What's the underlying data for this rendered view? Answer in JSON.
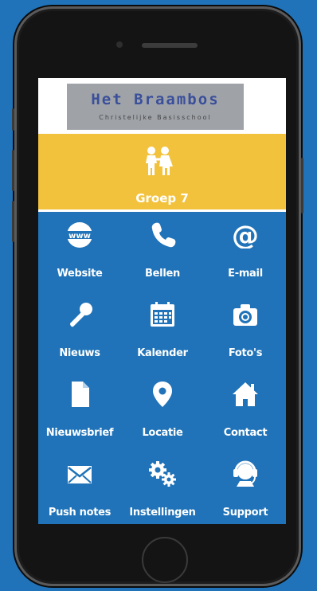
{
  "header": {
    "logo_title": "Het Braambos",
    "logo_subtitle": "Christelijke Basisschool"
  },
  "group": {
    "label": "Groep 7",
    "icon": "children-icon"
  },
  "tiles": [
    {
      "label": "Website",
      "icon": "www-icon"
    },
    {
      "label": "Bellen",
      "icon": "phone-icon"
    },
    {
      "label": "E-mail",
      "icon": "at-icon"
    },
    {
      "label": "Nieuws",
      "icon": "microphone-icon"
    },
    {
      "label": "Kalender",
      "icon": "calendar-icon"
    },
    {
      "label": "Foto's",
      "icon": "camera-icon"
    },
    {
      "label": "Nieuwsbrief",
      "icon": "document-icon"
    },
    {
      "label": "Locatie",
      "icon": "location-pin-icon"
    },
    {
      "label": "Contact",
      "icon": "home-icon"
    },
    {
      "label": "Push notes",
      "icon": "envelope-icon"
    },
    {
      "label": "Instellingen",
      "icon": "gears-icon"
    },
    {
      "label": "Support",
      "icon": "headset-icon"
    }
  ],
  "colors": {
    "background": "#2073b8",
    "group_bar": "#f2c23c",
    "tile_text": "#ffffff"
  }
}
